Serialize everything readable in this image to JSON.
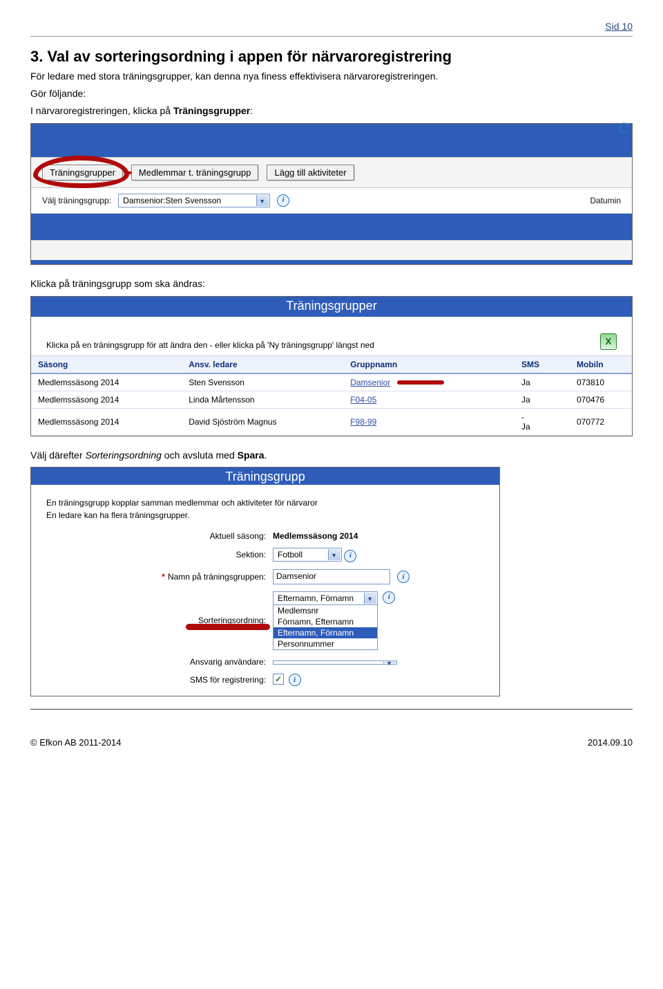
{
  "page": {
    "number": "Sid 10"
  },
  "section": {
    "heading": "3. Val av sorteringsordning i appen för närvaroregistrering",
    "para1": "För ledare med stora träningsgrupper, kan denna nya finess effektivisera närvaroregistreringen.",
    "para2": "Gör följande:",
    "step1_prefix": "I närvaroregistreringen, klicka på ",
    "step1_bold": "Träningsgrupper",
    "step1_suffix": ":",
    "step2": "Klicka på träningsgrupp som ska ändras:",
    "step3_prefix": "Välj därefter ",
    "step3_italic": "Sorteringsordning",
    "step3_mid": " och avsluta med ",
    "step3_bold": "Spara",
    "step3_suffix": "."
  },
  "ss1": {
    "buttons": {
      "grupper": "Träningsgrupper",
      "medlemmar": "Medlemmar t. träningsgrupp",
      "lagg": "Lägg till aktiviteter"
    },
    "label_valj": "Välj träningsgrupp:",
    "select_value": "Damsenior:Sten Svensson",
    "right_text": "Datumin"
  },
  "ss2": {
    "title": "Träningsgrupper",
    "intro": "Klicka på en träningsgrupp för att ändra den - eller klicka på 'Ny träningsgrupp' längst ned",
    "cols": {
      "sasong": "Säsong",
      "ansv": "Ansv. ledare",
      "grupp": "Gruppnamn",
      "sms": "SMS",
      "mobil": "Mobiln"
    },
    "rows": [
      {
        "sasong": "Medlemssäsong 2014",
        "ansv": "Sten Svensson",
        "grupp": "Damsenior",
        "sms": "Ja",
        "mobil": "073810",
        "mark": true
      },
      {
        "sasong": "Medlemssäsong 2014",
        "ansv": "Linda Mårtensson",
        "grupp": "F04-05",
        "sms": "Ja",
        "mobil": "070476",
        "mark": false
      },
      {
        "sasong": "Medlemssäsong 2014",
        "ansv": "David Sjöström Magnus",
        "grupp": "F98-99",
        "sms": "-\nJa",
        "mobil": "070772",
        "mark": false
      }
    ]
  },
  "ss3": {
    "title": "Träningsgrupp",
    "intro1": "En träningsgrupp kopplar samman medlemmar och aktiviteter för närvaror",
    "intro2": "En ledare kan ha flera träningsgrupper.",
    "labels": {
      "sasong": "Aktuell säsong:",
      "sektion": "Sektion:",
      "namn": "Namn på träningsgruppen:",
      "sortering": "Sorteringsordning:",
      "ansvarig": "Ansvarig användare:",
      "sms": "SMS för registrering:"
    },
    "values": {
      "sasong": "Medlemssäsong 2014",
      "sektion": "Fotboll",
      "namn": "Damsenior",
      "sortering_current": "Efternamn, Förnamn",
      "sort_options": [
        "Medlemsnr",
        "Förnamn, Efternamn",
        "Efternamn, Förnamn",
        "Personnummer"
      ],
      "sort_selected_index": 2,
      "ansvarig": ""
    }
  },
  "footer": {
    "left": "© Efkon AB 2011-2014",
    "right": "2014.09.10"
  }
}
